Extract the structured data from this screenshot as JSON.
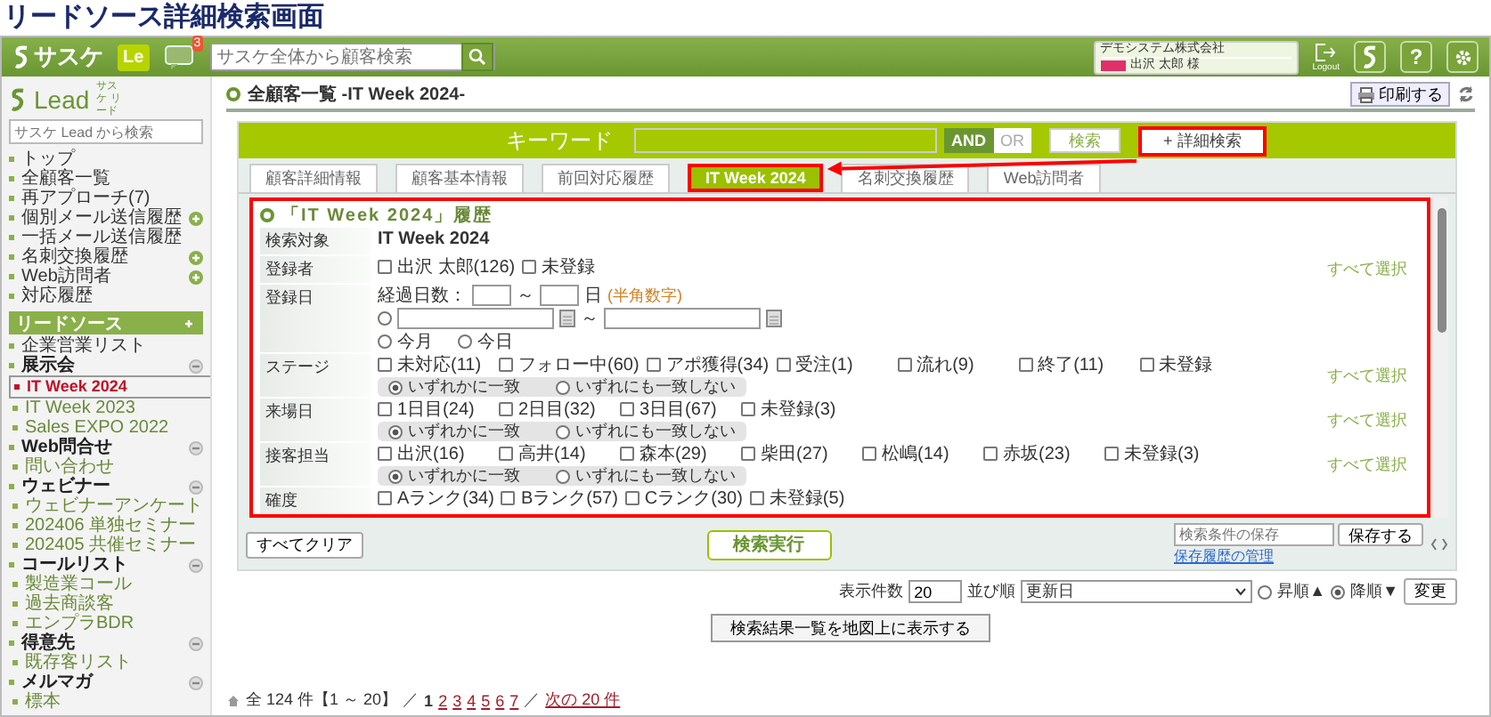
{
  "page_title": "リードソース詳細検索画面",
  "header": {
    "logo": "サスケ",
    "app_badge": "Le",
    "notification_count": "3",
    "search_placeholder": "サスケ全体から顧客検索",
    "company": "デモシステム株式会社",
    "user": "出沢 太郎 様",
    "logout_label": "Logout",
    "help_glyph": "?"
  },
  "sidebar": {
    "logo": "Lead",
    "logo_sub": "サスケ リード",
    "search_placeholder": "サスケ Lead から検索",
    "nav": [
      {
        "label": "トップ",
        "addable": false
      },
      {
        "label": "全顧客一覧",
        "addable": false
      },
      {
        "label": "再アプローチ(7)",
        "addable": false
      },
      {
        "label": "個別メール送信履歴",
        "addable": true
      },
      {
        "label": "一括メール送信履歴",
        "addable": false
      },
      {
        "label": "名刺交換履歴",
        "addable": true
      },
      {
        "label": "Web訪問者",
        "addable": true
      },
      {
        "label": "対応履歴",
        "addable": false
      }
    ],
    "section": "リードソース",
    "source_items": [
      {
        "label": "企業営業リスト",
        "selected": false
      }
    ],
    "groups": [
      {
        "label": "展示会",
        "expanded": true,
        "children": [
          {
            "label": "IT Week 2024",
            "selected": true
          },
          {
            "label": "IT Week 2023",
            "selected": false
          },
          {
            "label": "Sales EXPO 2022",
            "selected": false
          }
        ]
      },
      {
        "label": "Web問合せ",
        "expanded": true,
        "children": [
          {
            "label": "問い合わせ",
            "selected": false
          }
        ]
      },
      {
        "label": "ウェビナー",
        "expanded": true,
        "children": [
          {
            "label": "ウェビナーアンケート",
            "selected": false
          },
          {
            "label": "202406 単独セミナー",
            "selected": false
          },
          {
            "label": "202405 共催セミナー",
            "selected": false
          }
        ]
      },
      {
        "label": "コールリスト",
        "expanded": true,
        "children": [
          {
            "label": "製造業コール",
            "selected": false
          },
          {
            "label": "過去商談客",
            "selected": false
          },
          {
            "label": "エンプラBDR",
            "selected": false
          }
        ]
      },
      {
        "label": "得意先",
        "expanded": true,
        "children": [
          {
            "label": "既存客リスト",
            "selected": false
          }
        ]
      },
      {
        "label": "メルマガ",
        "expanded": true,
        "children": [
          {
            "label": "標本",
            "selected": false
          }
        ]
      }
    ]
  },
  "breadcrumb": "全顧客一覧 -IT Week 2024-",
  "print_button": "印刷する",
  "keyword": {
    "label": "キーワード",
    "modes": [
      {
        "label": "AND",
        "selected": true
      },
      {
        "label": "OR",
        "selected": false
      }
    ],
    "search_button": "検索",
    "detail_button": {
      "label": "+ 詳細検索",
      "highlighted": true
    }
  },
  "tabs": [
    {
      "label": "顧客詳細情報",
      "selected": false,
      "highlighted": false
    },
    {
      "label": "顧客基本情報",
      "selected": false,
      "highlighted": false
    },
    {
      "label": "前回対応履歴",
      "selected": false,
      "highlighted": false
    },
    {
      "label": "IT Week 2024",
      "selected": true,
      "highlighted": true
    },
    {
      "label": "名刺交換履歴",
      "selected": false,
      "highlighted": false
    },
    {
      "label": "Web訪問者",
      "selected": false,
      "highlighted": false
    }
  ],
  "annotation_arrow": true,
  "panel": {
    "highlighted": true,
    "title": "「IT Week 2024」履歴",
    "rows": [
      {
        "kind": "text",
        "label": "検索対象",
        "value": "IT Week 2024"
      },
      {
        "kind": "checks",
        "label": "登録者",
        "options": [
          {
            "label": "出沢 太郎(126)",
            "checked": false
          },
          {
            "label": "未登録",
            "checked": false
          }
        ],
        "select_all": "すべて選択"
      },
      {
        "kind": "date",
        "label": "登録日",
        "days_label": "経過日数：",
        "tilde": "～",
        "days_unit": "日",
        "hint": "(半角数字)",
        "range_selected": false,
        "range_tilde": "～",
        "periods": [
          {
            "label": "今月",
            "selected": false
          },
          {
            "label": "今日",
            "selected": false
          }
        ]
      },
      {
        "kind": "checks",
        "label": "ステージ",
        "options": [
          {
            "label": "未対応(11)",
            "checked": false
          },
          {
            "label": "フォロー中(60)",
            "checked": false
          },
          {
            "label": "アポ獲得(34)",
            "checked": false
          },
          {
            "label": "受注(1)",
            "checked": false
          },
          {
            "label": "流れ(9)",
            "checked": false
          },
          {
            "label": "終了(11)",
            "checked": false
          },
          {
            "label": "未登録",
            "checked": false
          }
        ],
        "match": [
          {
            "label": "いずれかに一致",
            "selected": true
          },
          {
            "label": "いずれにも一致しない",
            "selected": false
          }
        ],
        "select_all": "すべて選択"
      },
      {
        "kind": "checks",
        "label": "来場日",
        "options": [
          {
            "label": "1日目(24)",
            "checked": false
          },
          {
            "label": "2日目(32)",
            "checked": false
          },
          {
            "label": "3日目(67)",
            "checked": false
          },
          {
            "label": "未登録(3)",
            "checked": false
          }
        ],
        "match": [
          {
            "label": "いずれかに一致",
            "selected": true
          },
          {
            "label": "いずれにも一致しない",
            "selected": false
          }
        ],
        "select_all": "すべて選択"
      },
      {
        "kind": "checks",
        "label": "接客担当",
        "options": [
          {
            "label": "出沢(16)",
            "checked": false
          },
          {
            "label": "高井(14)",
            "checked": false
          },
          {
            "label": "森本(29)",
            "checked": false
          },
          {
            "label": "柴田(27)",
            "checked": false
          },
          {
            "label": "松嶋(14)",
            "checked": false
          },
          {
            "label": "赤坂(23)",
            "checked": false
          },
          {
            "label": "未登録(3)",
            "checked": false
          }
        ],
        "match": [
          {
            "label": "いずれかに一致",
            "selected": true
          },
          {
            "label": "いずれにも一致しない",
            "selected": false
          }
        ],
        "select_all": "すべて選択"
      },
      {
        "kind": "checks",
        "label": "確度",
        "options": [
          {
            "label": "Aランク(34)",
            "checked": false
          },
          {
            "label": "Bランク(57)",
            "checked": false
          },
          {
            "label": "Cランク(30)",
            "checked": false
          },
          {
            "label": "未登録(5)",
            "checked": false
          }
        ]
      }
    ]
  },
  "footer": {
    "clear_button": "すべてクリア",
    "execute_button": "検索実行",
    "save_placeholder": "検索条件の保存",
    "save_button": "保存する",
    "manage_link": "保存履歴の管理"
  },
  "results": {
    "per_page_label": "表示件数",
    "per_page": "20",
    "sort_label": "並び順",
    "sort_value": "更新日",
    "orders": [
      {
        "label": "昇順▲",
        "selected": false
      },
      {
        "label": "降順▼",
        "selected": true
      }
    ],
    "apply_button": "変更",
    "map_button": "検索結果一覧を地図上に表示する",
    "pagination": {
      "summary": "全 124 件【1 ～ 20】",
      "separator": "／",
      "pages": [
        {
          "label": "1",
          "selected": true
        },
        {
          "label": "2",
          "selected": false
        },
        {
          "label": "3",
          "selected": false
        },
        {
          "label": "4",
          "selected": false
        },
        {
          "label": "5",
          "selected": false
        },
        {
          "label": "6",
          "selected": false
        },
        {
          "label": "7",
          "selected": false
        }
      ],
      "separator_2": "／",
      "next": "次の 20 件"
    }
  }
}
